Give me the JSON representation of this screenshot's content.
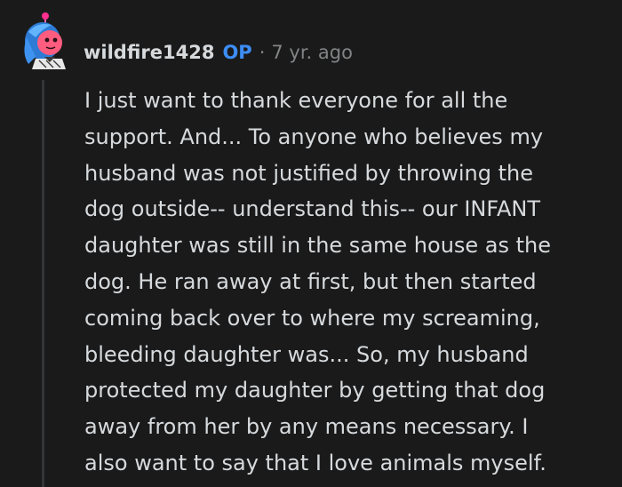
{
  "comment": {
    "author": "wildfire1428",
    "op_badge": "OP",
    "separator": "·",
    "timestamp": "7 yr. ago",
    "body": "I just want to thank everyone for all the\nsupport. And... To anyone who believes my\nhusband was not justified by throwing the\ndog outside-- understand this-- our INFANT\ndaughter was still in the same house as the\ndog. He ran away at first, but then started\ncoming back over to where my screaming,\nbleeding daughter was... So, my husband\nprotected my daughter by getting that dog\naway from her by any means necessary. I\nalso want to say that I love animals myself."
  },
  "colors": {
    "background": "#1a1a1b",
    "text": "#d7dadc",
    "op_badge": "#3d8df5",
    "meta": "#818384",
    "thread_line": "#343536"
  },
  "icons": {
    "avatar": "snoo-avatar-icon"
  }
}
